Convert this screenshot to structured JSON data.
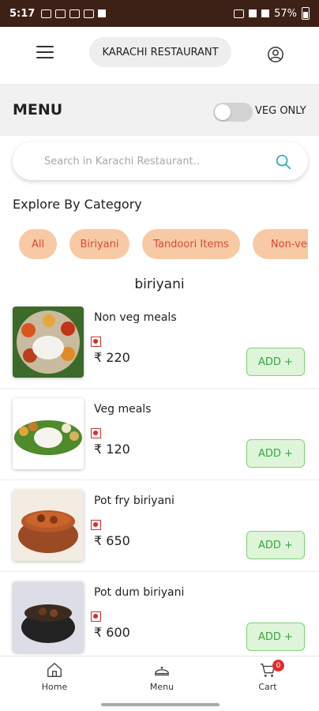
{
  "status_bar": {
    "time": "5:17",
    "battery": "57%"
  },
  "header": {
    "restaurant_name": "KARACHI RESTAURANT",
    "menu_icon": "hamburger-icon",
    "profile_icon": "user-circle-icon"
  },
  "menu_section": {
    "title": "MENU",
    "veg_only_label": "VEG ONLY",
    "veg_only_enabled": false
  },
  "search": {
    "placeholder": "Search in Karachi Restaurant..",
    "value": ""
  },
  "categories": {
    "heading": "Explore By Category",
    "items": [
      "All",
      "Biriyani",
      "Tandoori Items",
      "Non-veg"
    ]
  },
  "section": {
    "title": "biriyani"
  },
  "items": [
    {
      "name": "Non veg meals",
      "price": "₹ 220",
      "add_label": "ADD +"
    },
    {
      "name": "Veg meals",
      "price": "₹ 120",
      "add_label": "ADD +"
    },
    {
      "name": "Pot fry biriyani",
      "price": "₹ 650",
      "add_label": "ADD +"
    },
    {
      "name": "Pot dum biriyani",
      "price": "₹ 600",
      "add_label": "ADD +"
    }
  ],
  "bottom_nav": {
    "home": "Home",
    "menu": "Menu",
    "cart": "Cart",
    "cart_count": "0"
  },
  "colors": {
    "status_bar": "#3e2116",
    "category_pill_bg": "#f7c9a4",
    "category_pill_text": "#d84a3a",
    "add_button_text": "#3aa340",
    "non_veg_mark": "#d32f2f",
    "search_icon": "#2bb3c0"
  }
}
